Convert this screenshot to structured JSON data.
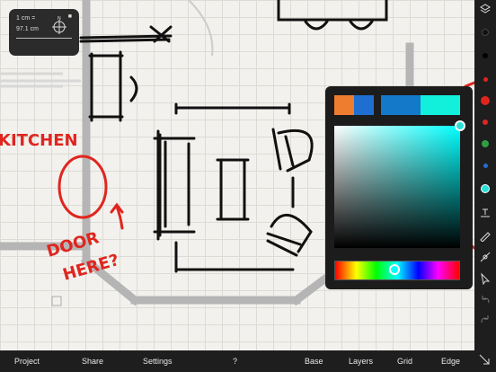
{
  "scale": {
    "line1": "1 cm =",
    "line2": "97.1 cm"
  },
  "annotations": {
    "kitchen": "KITCHEN",
    "door": "DOOR",
    "here": "HERE?"
  },
  "colors": {
    "ink": "#111111",
    "annotation_red": "#e0251f",
    "toolbar_bg": "#1e1e1e",
    "palette": [
      "#111111",
      "#e0251f",
      "#e0251f",
      "#e0251f",
      "#2ea043",
      "#2ea043",
      "#1f6fd1",
      "#29e0d7"
    ]
  },
  "color_picker": {
    "swatches": [
      "#ef7d2f",
      "#1f6fd1",
      "#1479c9",
      "#12f0dc"
    ],
    "hue_position": 0.5,
    "selected": "#29e0d7"
  },
  "toolbar": {
    "icons": [
      "layers-icon",
      "brush-icon",
      "node-icon",
      "distance-icon",
      "brush-fill-icon",
      "pen-line-icon",
      "select-arrow-icon",
      "undo-icon",
      "redo-icon"
    ]
  },
  "bottom_bar": {
    "project": "Project",
    "share": "Share",
    "settings": "Settings",
    "help": "?",
    "base": "Base",
    "layers": "Layers",
    "grid": "Grid",
    "edge": "Edge"
  }
}
